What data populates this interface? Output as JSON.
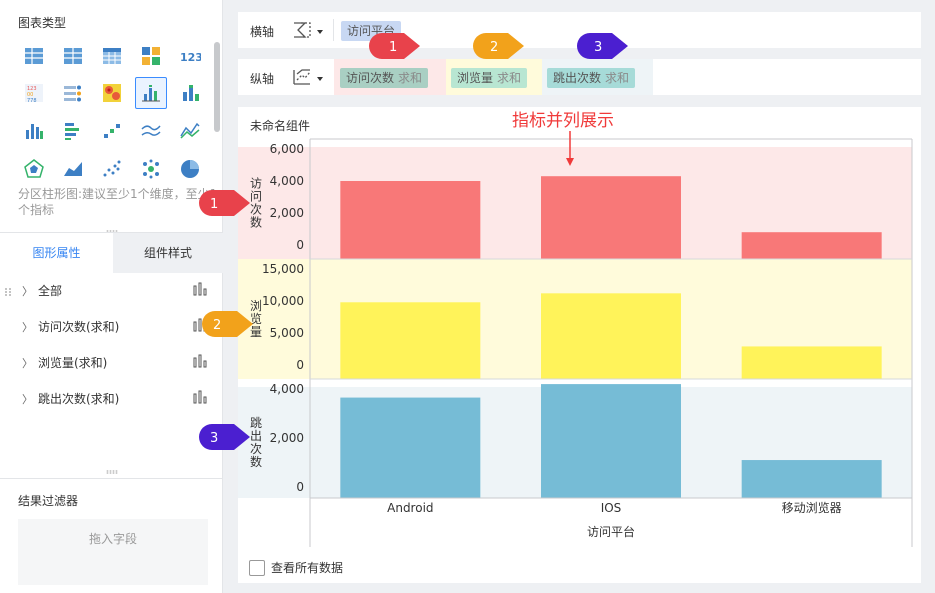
{
  "left_panel": {
    "chart_type_title": "图表类型",
    "chart_type_icons": [
      "table-icon",
      "cross-table-icon",
      "detail-table-icon",
      "multi-color-block-icon",
      "kpi-number-icon",
      "kpi-card-icon",
      "kpi-list-icon",
      "heatmap-icon",
      "partition-bar-icon",
      "stacked-bar-icon",
      "bar-chart-icon",
      "horizontal-bar-icon",
      "scatter-dot-icon",
      "line-chart-icon",
      "area-line-icon",
      "radar-icon",
      "area-chart-icon",
      "scatter-icon",
      "bubble-icon",
      "pie-icon"
    ],
    "chart_type_description": "分区柱形图:建议至少1个维度，至少1个指标",
    "tabs": {
      "attributes": "图形属性",
      "component_style": "组件样式"
    },
    "attribute_items": [
      "全部",
      "访问次数(求和)",
      "浏览量(求和)",
      "跳出次数(求和)"
    ],
    "filter_title": "结果过滤器",
    "filter_drop_placeholder": "拖入字段"
  },
  "x_axis": {
    "label": "横轴",
    "field": "访问平台"
  },
  "y_axis": {
    "label": "纵轴",
    "fields": [
      {
        "name": "访问次数",
        "agg": "求和"
      },
      {
        "name": "浏览量",
        "agg": "求和"
      },
      {
        "name": "跳出次数",
        "agg": "求和"
      }
    ]
  },
  "chart_panel": {
    "component_name": "未命名组件",
    "annotation": "指标并列展示",
    "show_all_data": "查看所有数据"
  },
  "badges": [
    "1",
    "2",
    "3",
    "1",
    "2",
    "3"
  ],
  "colors": {
    "accent": "#3685f2",
    "series_1": "#f87878",
    "series_2": "#fff35a",
    "series_3": "#76bcd6",
    "band_1": "#fde8e8",
    "band_2": "#fffbdb",
    "band_3": "#eef4f7",
    "badge_red": "#e8424b",
    "badge_orange": "#f2a21b",
    "badge_purple": "#4b1fd0"
  },
  "chart_data": {
    "type": "bar",
    "layout": "partitioned-vertical",
    "categories": [
      "Android",
      "IOS",
      "移动浏览器"
    ],
    "xlabel": "访问平台",
    "grid": false,
    "series": [
      {
        "name": "访问次数",
        "axis_label": "访问次数",
        "values": [
          4000,
          4300,
          800
        ],
        "ylim": [
          0,
          6000
        ],
        "ticks": [
          "6,000",
          "4,000",
          "2,000",
          "0"
        ]
      },
      {
        "name": "浏览量",
        "axis_label": "浏览量",
        "values": [
          9800,
          11200,
          2900
        ],
        "ylim": [
          0,
          15000
        ],
        "ticks": [
          "15,000",
          "10,000",
          "5,000",
          "0"
        ]
      },
      {
        "name": "跳出次数",
        "axis_label": "跳出次数",
        "values": [
          3650,
          4200,
          1100
        ],
        "ylim": [
          0,
          4000
        ],
        "ticks": [
          "4,000",
          "2,000",
          "0"
        ]
      }
    ]
  }
}
